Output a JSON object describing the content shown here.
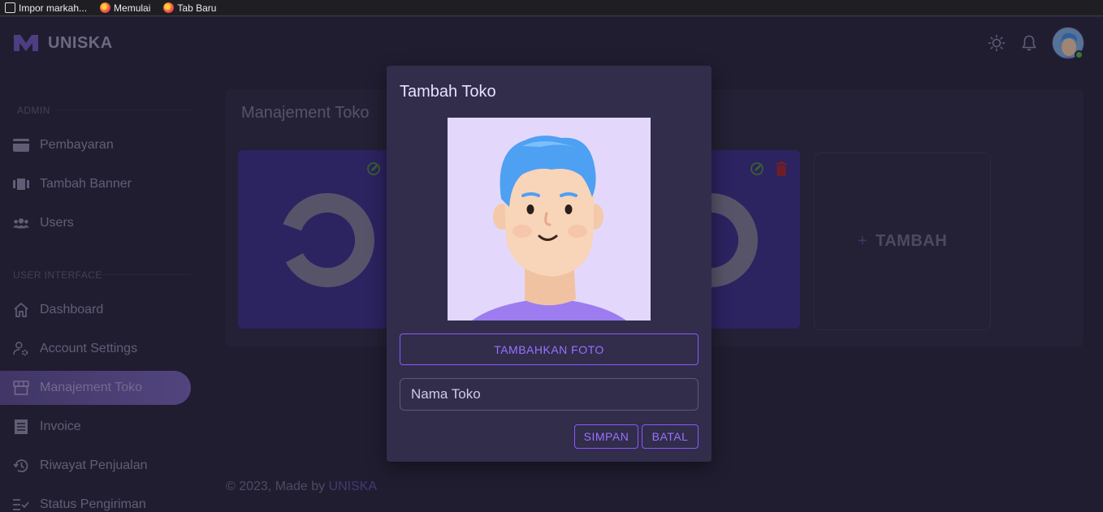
{
  "browser": {
    "bookmarks": [
      {
        "label": "Impor markah...",
        "icon": "import-icon"
      },
      {
        "label": "Memulai",
        "icon": "firefox-icon"
      },
      {
        "label": "Tab Baru",
        "icon": "firefox-icon"
      }
    ]
  },
  "app": {
    "brand": "UNISKA",
    "accent": "#8c57ff"
  },
  "sidebar": {
    "sections": [
      {
        "title": "ADMIN"
      },
      {
        "title": "USER INTERFACE"
      }
    ],
    "items": [
      {
        "label": "Pembayaran",
        "icon": "credit-card-icon"
      },
      {
        "label": "Tambah Banner",
        "icon": "view-carousel-icon"
      },
      {
        "label": "Users",
        "icon": "users-icon"
      },
      {
        "label": "Dashboard",
        "icon": "home-icon"
      },
      {
        "label": "Account Settings",
        "icon": "account-cog-icon"
      },
      {
        "label": "Manajement Toko",
        "icon": "store-icon",
        "active": true
      },
      {
        "label": "Invoice",
        "icon": "invoice-icon"
      },
      {
        "label": "Riwayat Penjualan",
        "icon": "history-icon"
      },
      {
        "label": "Status Pengiriman",
        "icon": "checklist-icon"
      }
    ]
  },
  "main": {
    "title": "Manajement Toko",
    "add_label": "TAMBAH",
    "footer_text": "© 2023, Made by ",
    "footer_link": "UNISKA"
  },
  "modal": {
    "title": "Tambah Toko",
    "add_photo_label": "TAMBAHKAN FOTO",
    "name_placeholder": "Nama Toko",
    "save_label": "SIMPAN",
    "cancel_label": "BATAL"
  }
}
